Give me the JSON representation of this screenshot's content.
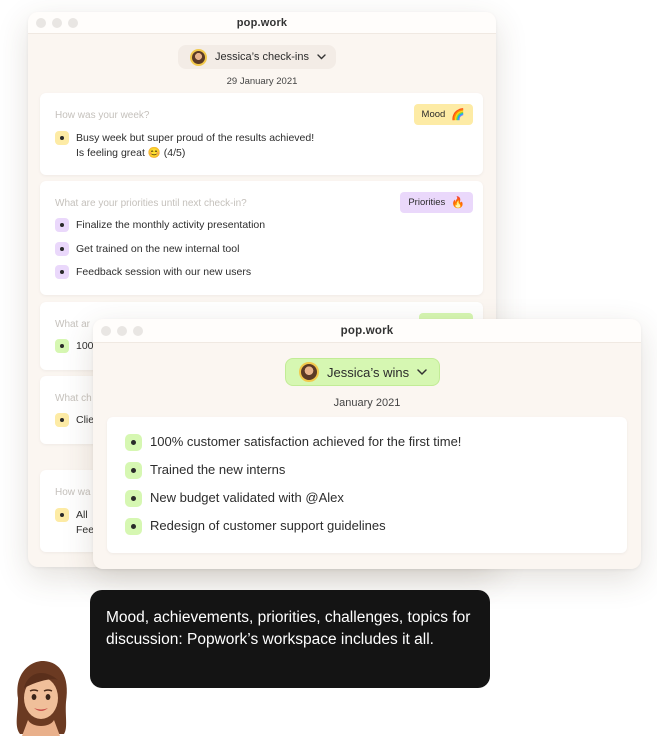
{
  "checkins_window": {
    "title": "pop.work",
    "selector_label": "Jessica’s check-ins",
    "date": "29 January 2021",
    "sections": [
      {
        "question": "How was your week?",
        "tag": "Mood",
        "tag_emoji": "🌈",
        "items": [
          "Busy week but super proud of the results achieved!",
          "Is feeling great 😊 (4/5)"
        ]
      },
      {
        "question": "What are your priorities until next check-in?",
        "tag": "Priorities",
        "tag_emoji": "🔥",
        "items": [
          "Finalize the monthly activity presentation",
          "Get trained on the new internal tool",
          "Feedback session with our new users"
        ]
      },
      {
        "question": "What ar",
        "items": [
          "100"
        ]
      },
      {
        "question": "What ch",
        "items": [
          "Clie"
        ]
      },
      {
        "question": "How wa",
        "items": [
          "All",
          "Fee"
        ]
      }
    ]
  },
  "wins_window": {
    "title": "pop.work",
    "selector_label": "Jessica’s wins",
    "date": "January 2021",
    "items": [
      "100% customer satisfaction achieved for the first time!",
      "Trained the new interns",
      "New budget validated with @Alex",
      "Redesign of customer support guidelines"
    ]
  },
  "caption": "Mood, achievements, priorities, challenges, topics for discussion: Popwork’s workspace includes it all.",
  "colors": {
    "mood_tag": "#fdeba5",
    "priorities_tag": "#ead8fb",
    "wins_selector": "#d6f7b2",
    "caption_bg": "#141414"
  }
}
